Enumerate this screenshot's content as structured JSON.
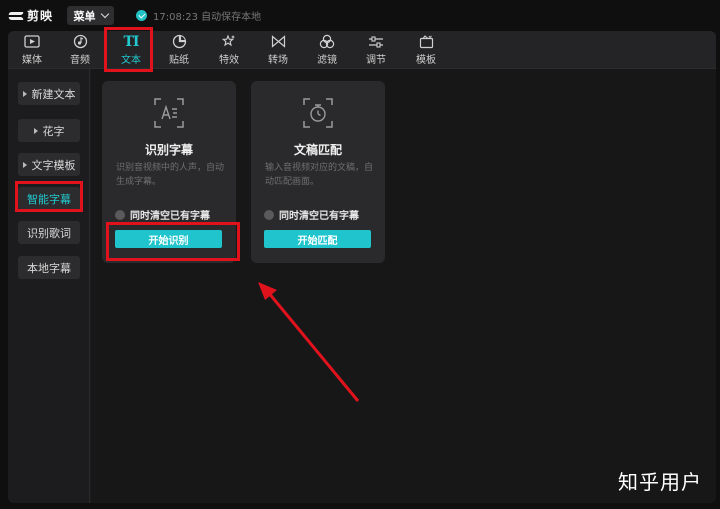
{
  "app": {
    "name": "剪映"
  },
  "topbar": {
    "menu_label": "菜单",
    "save_status": "17:08:23 自动保存本地"
  },
  "tabs": [
    {
      "label": "媒体",
      "icon": "media-icon"
    },
    {
      "label": "音频",
      "icon": "audio-icon"
    },
    {
      "label": "文本",
      "icon": "text-icon",
      "active": true
    },
    {
      "label": "贴纸",
      "icon": "sticker-icon"
    },
    {
      "label": "特效",
      "icon": "effects-icon"
    },
    {
      "label": "转场",
      "icon": "transition-icon"
    },
    {
      "label": "滤镜",
      "icon": "filter-icon"
    },
    {
      "label": "调节",
      "icon": "adjust-icon"
    },
    {
      "label": "模板",
      "icon": "template-icon"
    }
  ],
  "tab_text_icon_glyph": "TI",
  "sidebar": {
    "items": [
      {
        "label": "新建文本",
        "expandable": true
      },
      {
        "label": "花字",
        "expandable": true
      },
      {
        "label": "文字模板",
        "expandable": true
      },
      {
        "label": "智能字幕",
        "active": true
      },
      {
        "label": "识别歌词"
      },
      {
        "label": "本地字幕"
      }
    ]
  },
  "cards": [
    {
      "title": "识别字幕",
      "desc": "识别音视频中的人声，自动生成字幕。",
      "checkbox_label": "同时清空已有字幕",
      "button_label": "开始识别",
      "icon": "subtitle-recognition-icon"
    },
    {
      "title": "文稿匹配",
      "desc": "输入音视频对应的文稿，自动匹配画面。",
      "checkbox_label": "同时清空已有字幕",
      "button_label": "开始匹配",
      "icon": "script-match-icon"
    }
  ],
  "colors": {
    "accent": "#22c9cf",
    "annotation": "#e0121c",
    "button": "#1fc4cc"
  },
  "watermark": "知乎用户"
}
